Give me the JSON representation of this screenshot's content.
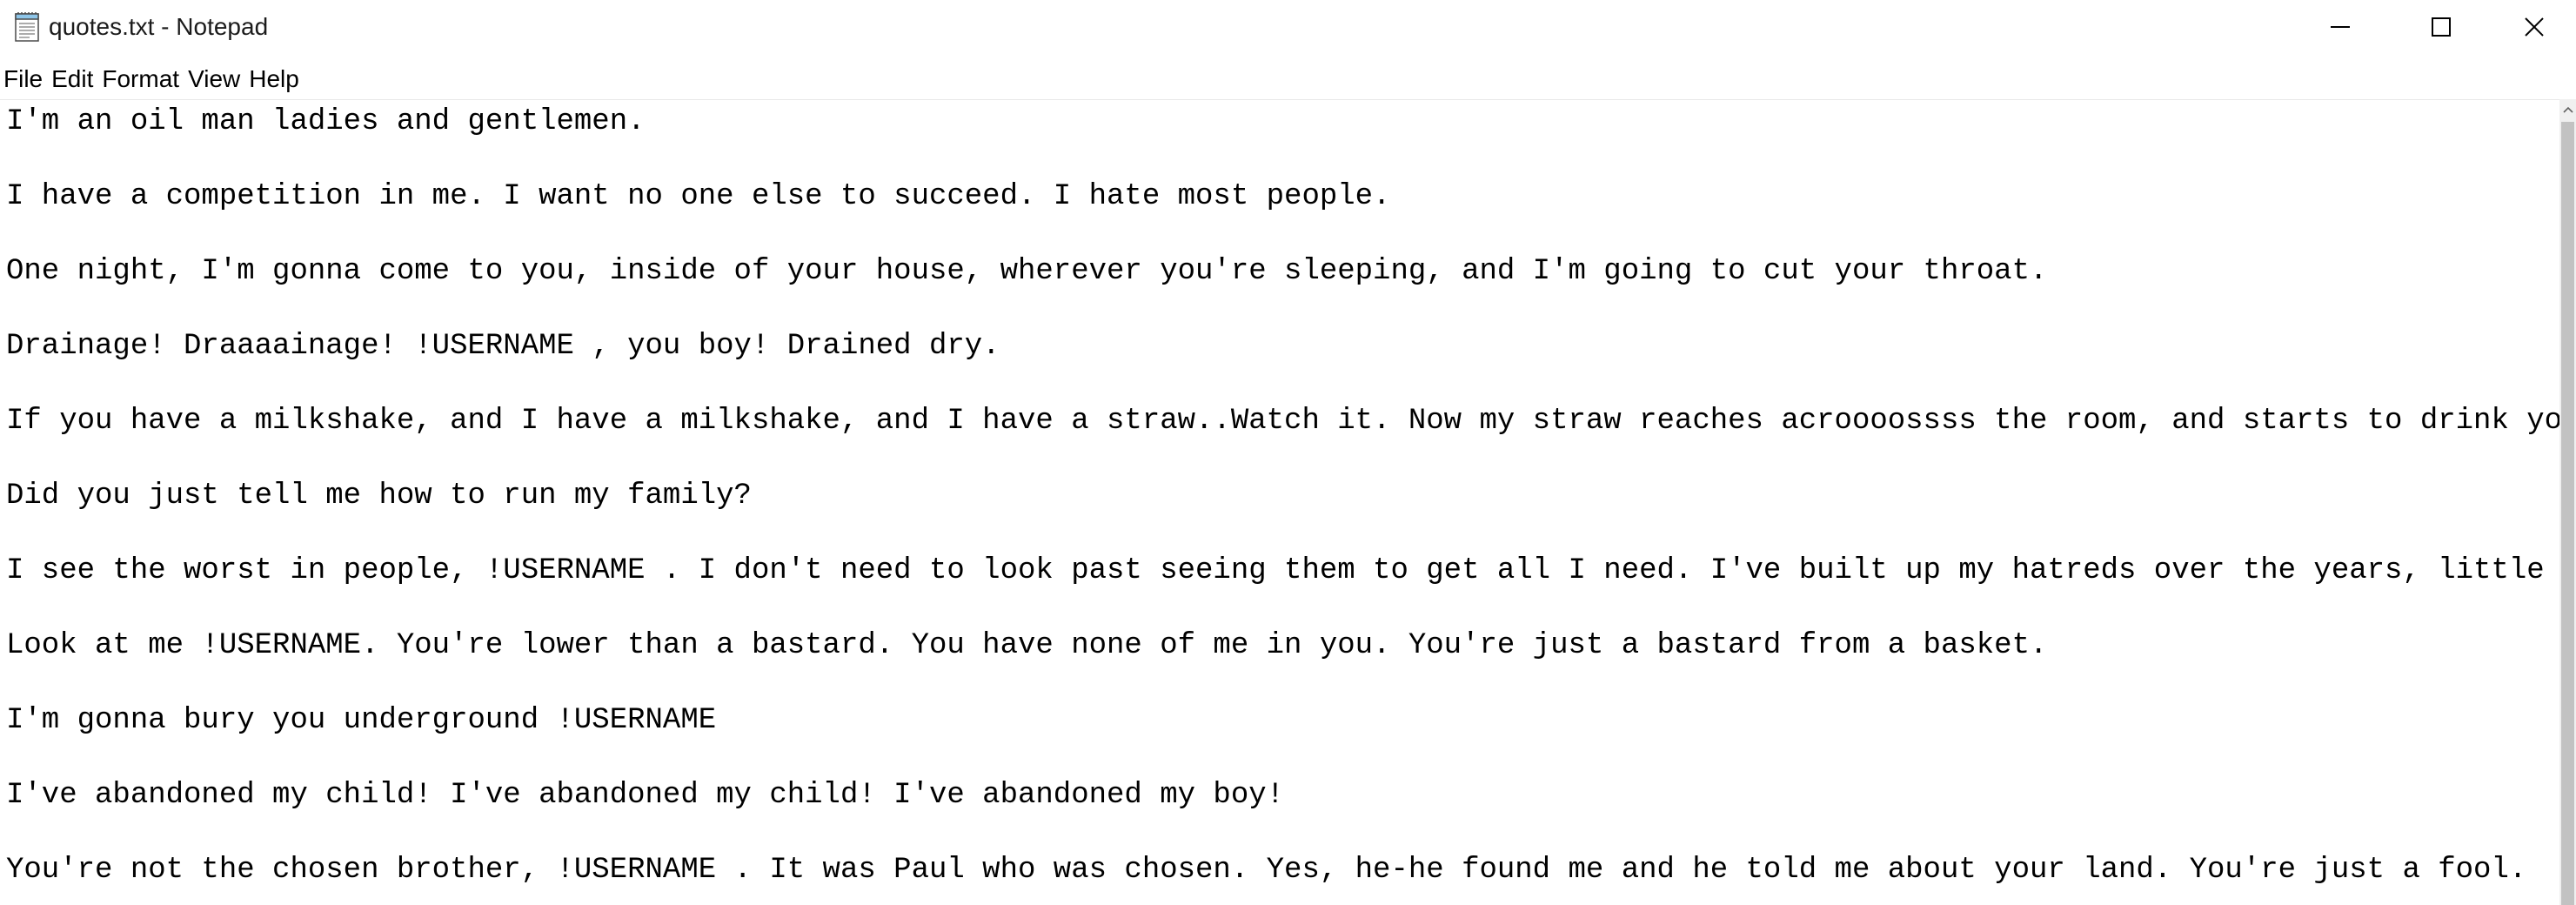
{
  "window": {
    "title": "quotes.txt - Notepad"
  },
  "menu": {
    "items": [
      "File",
      "Edit",
      "Format",
      "View",
      "Help"
    ]
  },
  "editor": {
    "lines": [
      "I'm an oil man ladies and gentlemen.",
      "I have a competition in me. I want no one else to succeed. I hate most people.",
      "One night, I'm gonna come to you, inside of your house, wherever you're sleeping, and I'm going to cut your throat.",
      "Drainage! Draaaainage! !USERNAME , you boy! Drained dry.",
      "If you have a milkshake, and I have a milkshake, and I have a straw..Watch it. Now my straw reaches acroooossss the room, and starts to drink your",
      "Did you just tell me how to run my family?",
      "I see the worst in people, !USERNAME . I don't need to look past seeing them to get all I need. I've built up my hatreds over the years, little by",
      "Look at me !USERNAME. You're lower than a bastard. You have none of me in you. You're just a bastard from a basket.",
      "I'm gonna bury you underground !USERNAME",
      "I've abandoned my child! I've abandoned my child! I've abandoned my boy!",
      "You're not the chosen brother, !USERNAME . It was Paul who was chosen. Yes, he-he found me and he told me about your land. You're just a fool."
    ]
  },
  "icons": {
    "app": "notepad-icon",
    "minimize": "minimize-icon",
    "maximize": "maximize-icon",
    "close": "close-icon",
    "scroll_up": "scroll-up-arrow-icon"
  },
  "colors": {
    "background": "#ffffff",
    "scrollbar_track": "#f0f0f0",
    "scrollbar_thumb": "#c2c2c2"
  }
}
